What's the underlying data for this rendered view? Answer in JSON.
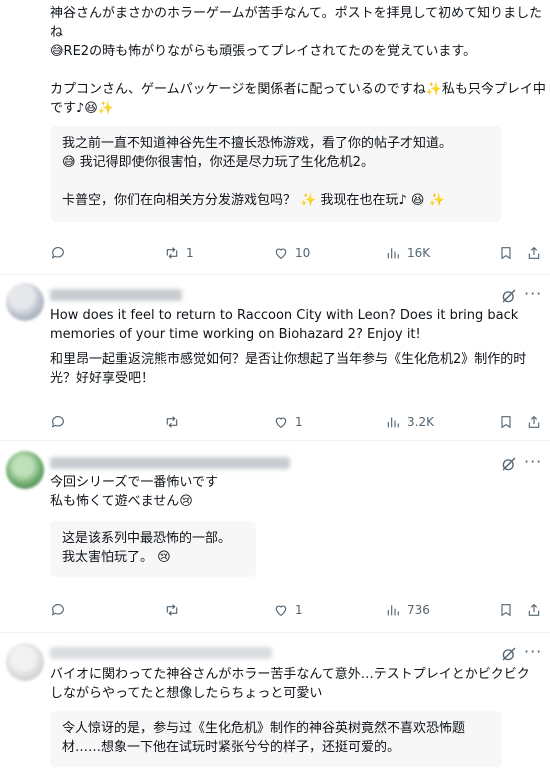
{
  "post1": {
    "ja_text": "神谷さんがまさかのホラーゲームが苦手なんて。ポストを拝見して初めて知りましたね\n😅RE2の時も怖がりながらも頑張ってプレイされてたのを覚えています。\n\nカプコンさん、ゲームパッケージを関係者に配っているのですね✨私も只今プレイ中です♪😆✨",
    "translation": "我之前一直不知道神谷先生不擅长恐怖游戏，看了你的帖子才知道。\n😅 我记得即使你很害怕，你还是尽力玩了生化危机2。\n\n卡普空，你们在向相关方分发游戏包吗？ ✨ 我现在也在玩♪ 😆 ✨",
    "reposts": "1",
    "likes": "10",
    "views": "16K"
  },
  "post2": {
    "text": "How does it feel to return to Raccoon City with Leon? Does it bring back memories of your time working on Biohazard 2? Enjoy it!",
    "translation_inline": "和里昂一起重返浣熊市感觉如何？是否让你想起了当年参与《生化危机2》制作的时光？好好享受吧！",
    "reposts": "",
    "likes": "1",
    "views": "3.2K"
  },
  "post3": {
    "text": "今回シリーズで一番怖いです\n私も怖くて遊べません😢",
    "translation": "这是该系列中最恐怖的一部。\n我太害怕玩了。 😢",
    "reposts": "",
    "likes": "1",
    "views": "736"
  },
  "post4": {
    "text": "バイオに関わってた神谷さんがホラー苦手なんて意外…テストプレイとかビクビクしながらやってたと想像したらちょっと可愛い",
    "translation": "令人惊讶的是，参与过《生化危机》制作的神谷英树竟然不喜欢恐怖题材……想象一下他在试玩时紧张兮兮的样子，还挺可爱的。"
  },
  "icons": [
    "reply-icon",
    "repost-icon",
    "like-icon",
    "views-icon",
    "bookmark-icon",
    "share-icon",
    "grok-icon",
    "more-icon"
  ]
}
